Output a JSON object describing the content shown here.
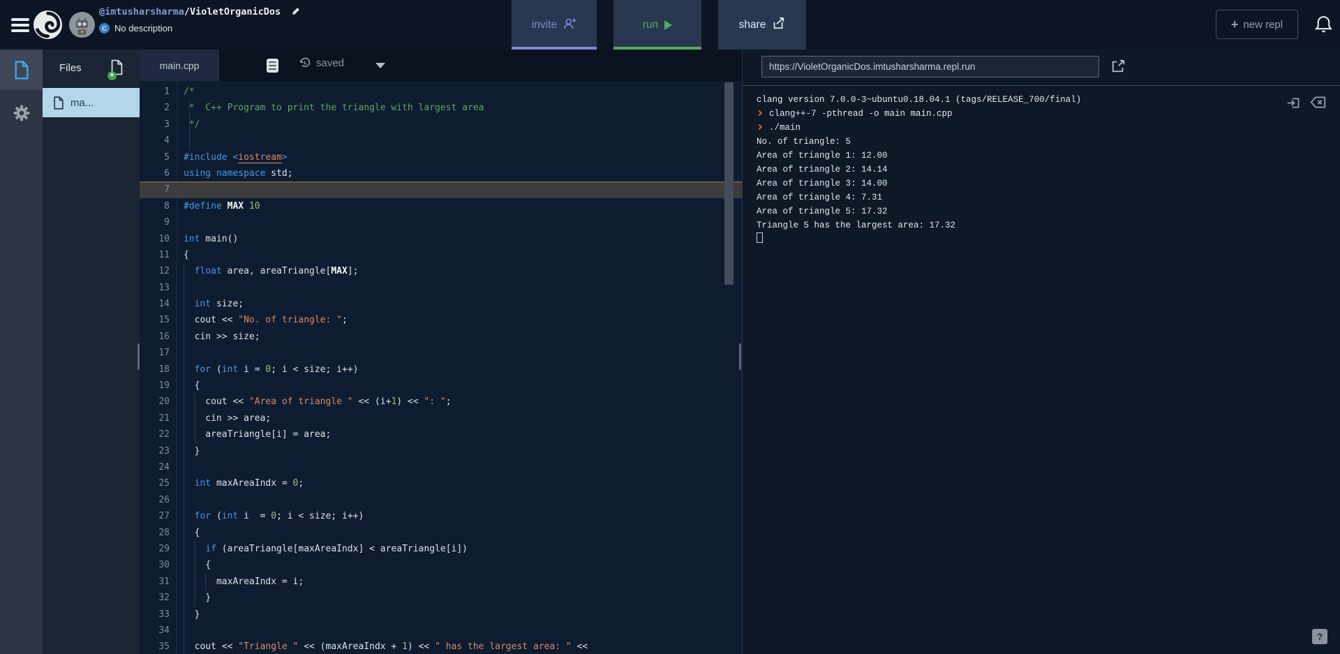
{
  "header": {
    "repl_owner": "@imtusharsharma",
    "repl_name": "/VioletOrganicDos",
    "description": "No description",
    "buttons": {
      "invite": "invite",
      "run": "run",
      "share": "share",
      "new_repl": "new repl",
      "new_repl_plus": "+"
    }
  },
  "files": {
    "title": "Files",
    "selected_file": "ma..."
  },
  "editor": {
    "tab": "main.cpp",
    "save_status": "saved",
    "active_line": 7,
    "lines": [
      {
        "n": 1,
        "tk": [
          [
            "c",
            "/*"
          ]
        ]
      },
      {
        "n": 2,
        "tk": [
          [
            "c",
            " *  C++ Program to print the triangle with largest area"
          ]
        ],
        "g": [
          1
        ]
      },
      {
        "n": 3,
        "tk": [
          [
            "c",
            " */"
          ]
        ],
        "g": [
          1
        ]
      },
      {
        "n": 4,
        "tk": [],
        "g": [
          1
        ]
      },
      {
        "n": 5,
        "tk": [
          [
            "k",
            "#include "
          ],
          [
            "k",
            "<"
          ],
          [
            "i",
            "iostream"
          ],
          [
            "k",
            ">"
          ]
        ]
      },
      {
        "n": 6,
        "tk": [
          [
            "k",
            "using"
          ],
          [
            "d",
            " "
          ],
          [
            "k",
            "namespace"
          ],
          [
            "d",
            " std;"
          ]
        ]
      },
      {
        "n": 7,
        "tk": []
      },
      {
        "n": 8,
        "tk": [
          [
            "k",
            "#define"
          ],
          [
            "d",
            " "
          ],
          [
            "b",
            "MAX"
          ],
          [
            "d",
            " "
          ],
          [
            "n",
            "10"
          ]
        ]
      },
      {
        "n": 9,
        "tk": []
      },
      {
        "n": 10,
        "tk": [
          [
            "k",
            "int"
          ],
          [
            "d",
            " main()"
          ]
        ]
      },
      {
        "n": 11,
        "tk": [
          [
            "d",
            "{"
          ]
        ]
      },
      {
        "n": 12,
        "tk": [
          [
            "d",
            "  "
          ],
          [
            "k",
            "float"
          ],
          [
            "d",
            " area, areaTriangle["
          ],
          [
            "b",
            "MAX"
          ],
          [
            "d",
            "];"
          ]
        ],
        "g": [
          0
        ]
      },
      {
        "n": 13,
        "tk": [],
        "g": [
          0
        ]
      },
      {
        "n": 14,
        "tk": [
          [
            "d",
            "  "
          ],
          [
            "k",
            "int"
          ],
          [
            "d",
            " size;"
          ]
        ],
        "g": [
          0
        ]
      },
      {
        "n": 15,
        "tk": [
          [
            "d",
            "  cout << "
          ],
          [
            "s",
            "\"No. of triangle: \""
          ],
          [
            "d",
            ";"
          ]
        ],
        "g": [
          0
        ]
      },
      {
        "n": 16,
        "tk": [
          [
            "d",
            "  cin >> size;"
          ]
        ],
        "g": [
          0
        ]
      },
      {
        "n": 17,
        "tk": [],
        "g": [
          0
        ]
      },
      {
        "n": 18,
        "tk": [
          [
            "d",
            "  "
          ],
          [
            "k",
            "for"
          ],
          [
            "d",
            " ("
          ],
          [
            "k",
            "int"
          ],
          [
            "d",
            " i = "
          ],
          [
            "n",
            "0"
          ],
          [
            "d",
            "; i < size; i++)"
          ]
        ],
        "g": [
          0
        ]
      },
      {
        "n": 19,
        "tk": [
          [
            "d",
            "  {"
          ]
        ],
        "g": [
          0
        ]
      },
      {
        "n": 20,
        "tk": [
          [
            "d",
            "    cout << "
          ],
          [
            "s",
            "\"Area of triangle \""
          ],
          [
            "d",
            " << (i+"
          ],
          [
            "n",
            "1"
          ],
          [
            "d",
            ") << "
          ],
          [
            "s",
            "\": \""
          ],
          [
            "d",
            ";"
          ]
        ],
        "g": [
          0,
          2
        ]
      },
      {
        "n": 21,
        "tk": [
          [
            "d",
            "    cin >> area;"
          ]
        ],
        "g": [
          0,
          2
        ]
      },
      {
        "n": 22,
        "tk": [
          [
            "d",
            "    areaTriangle[i] = area;"
          ]
        ],
        "g": [
          0,
          2
        ]
      },
      {
        "n": 23,
        "tk": [
          [
            "d",
            "  }"
          ]
        ],
        "g": [
          0
        ]
      },
      {
        "n": 24,
        "tk": [],
        "g": [
          0
        ]
      },
      {
        "n": 25,
        "tk": [
          [
            "d",
            "  "
          ],
          [
            "k",
            "int"
          ],
          [
            "d",
            " maxAreaIndx = "
          ],
          [
            "n",
            "0"
          ],
          [
            "d",
            ";"
          ]
        ],
        "g": [
          0
        ]
      },
      {
        "n": 26,
        "tk": [],
        "g": [
          0
        ]
      },
      {
        "n": 27,
        "tk": [
          [
            "d",
            "  "
          ],
          [
            "k",
            "for"
          ],
          [
            "d",
            " ("
          ],
          [
            "k",
            "int"
          ],
          [
            "d",
            " i  = "
          ],
          [
            "n",
            "0"
          ],
          [
            "d",
            "; i < size; i++)"
          ]
        ],
        "g": [
          0
        ]
      },
      {
        "n": 28,
        "tk": [
          [
            "d",
            "  {"
          ]
        ],
        "g": [
          0
        ]
      },
      {
        "n": 29,
        "tk": [
          [
            "d",
            "    "
          ],
          [
            "k",
            "if"
          ],
          [
            "d",
            " (areaTriangle[maxAreaIndx] < areaTriangle[i])"
          ]
        ],
        "g": [
          0,
          2
        ]
      },
      {
        "n": 30,
        "tk": [
          [
            "d",
            "    {"
          ]
        ],
        "g": [
          0,
          2
        ]
      },
      {
        "n": 31,
        "tk": [
          [
            "d",
            "      maxAreaIndx = i;"
          ]
        ],
        "g": [
          0,
          2,
          4
        ]
      },
      {
        "n": 32,
        "tk": [
          [
            "d",
            "    }"
          ]
        ],
        "g": [
          0,
          2
        ]
      },
      {
        "n": 33,
        "tk": [
          [
            "d",
            "  }"
          ]
        ],
        "g": [
          0
        ]
      },
      {
        "n": 34,
        "tk": [],
        "g": [
          0
        ]
      },
      {
        "n": 35,
        "tk": [
          [
            "d",
            "  cout << "
          ],
          [
            "s",
            "\"Triangle \""
          ],
          [
            "d",
            " << (maxAreaIndx + "
          ],
          [
            "n",
            "1"
          ],
          [
            "d",
            ") << "
          ],
          [
            "s",
            "\" has the largest area: \""
          ],
          [
            "d",
            " <<"
          ]
        ],
        "g": [
          0
        ]
      }
    ]
  },
  "console": {
    "url": "https://VioletOrganicDos.imtusharsharma.repl.run",
    "lines": [
      {
        "p": false,
        "t": "clang version 7.0.0-3~ubuntu0.18.04.1 (tags/RELEASE_700/final)"
      },
      {
        "p": true,
        "t": "clang++-7 -pthread -o main main.cpp"
      },
      {
        "p": true,
        "t": "./main"
      },
      {
        "p": false,
        "t": "No. of triangle: 5"
      },
      {
        "p": false,
        "t": "Area of triangle 1: 12.00"
      },
      {
        "p": false,
        "t": "Area of triangle 2: 14.14"
      },
      {
        "p": false,
        "t": "Area of triangle 3: 14.00"
      },
      {
        "p": false,
        "t": "Area of triangle 4: 7.31"
      },
      {
        "p": false,
        "t": "Area of triangle 5: 17.32"
      },
      {
        "p": false,
        "t": "Triangle 5 has the largest area: 17.32"
      }
    ],
    "show_cursor": true
  },
  "help_label": "?",
  "icons": {
    "menu": "hamburger",
    "logo": "replit-swirl",
    "avatar": "robot",
    "edit": "pencil",
    "language": "cpp-badge",
    "invite": "person-plus",
    "run": "play-triangle",
    "share": "share-arrow",
    "new_repl": "plus",
    "notifications": "bell",
    "files_tool": "file-doc",
    "settings": "gear",
    "add_file": "file-plus",
    "file": "doc",
    "format": "align-lines",
    "saved": "history-clock",
    "saved_menu": "caret-down",
    "open_external": "external-link",
    "focus_input": "enter-arrow",
    "clear_console": "backspace-x",
    "help": "question-mark"
  },
  "colors": {
    "header_bg": "#0d1524",
    "tabbar_bg": "#0a1220",
    "editor_bg": "#0d1c30",
    "console_bg": "#0e1826",
    "rail_bg": "#2d3544",
    "rail_tile_bg": "#3e4658",
    "files_bg": "#1a2433",
    "selected_file_bg": "#b2d7ea",
    "selected_file_text": "#333a44",
    "tab_bg": "#1d2a42",
    "btn_bg": "#273750",
    "accent_invite": "#7e86d8",
    "accent_run": "#53ab5e",
    "syn_keyword": "#4a96e8",
    "syn_string": "#d98a62",
    "syn_comment": "#5ca85c",
    "syn_number": "#98c379",
    "syn_default": "#dfe2e7",
    "gutter_text": "#7c8ca3",
    "active_line_bg": "#3a3c3e",
    "active_line_border": "#8a6038",
    "prompt": "#e2562a",
    "console_text": "#e6e9ee",
    "url_text": "#c9d1dc",
    "file_icon_blue": "#42a8e8",
    "add_badge_green": "#3fa24a"
  }
}
